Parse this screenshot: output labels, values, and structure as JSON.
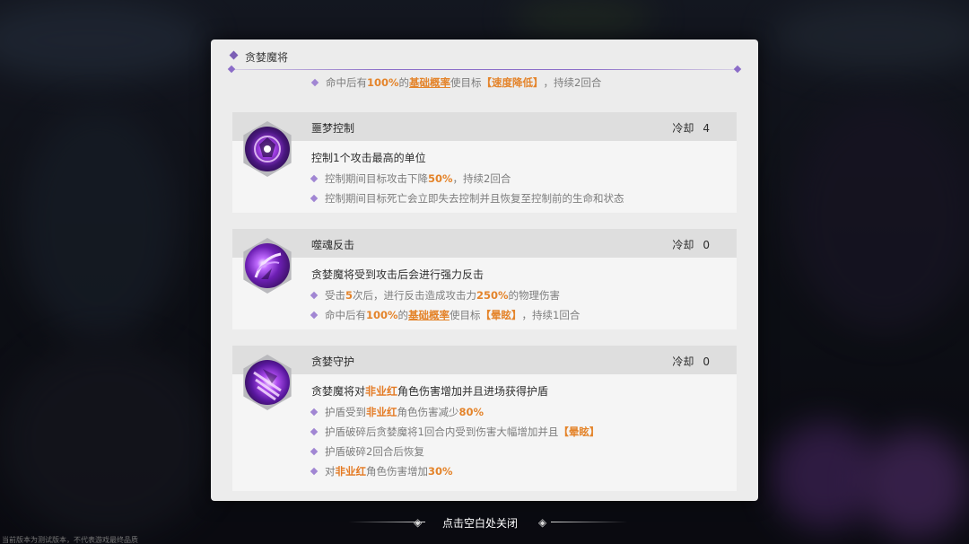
{
  "header": {
    "title": "贪婪魔将"
  },
  "top_effect": {
    "prefix": "命中后有",
    "rate": "100%",
    "mid": "的",
    "term": "基础概率",
    "after": "使目标",
    "status": "【速度降低】",
    "suffix": "，持续2回合"
  },
  "skills": [
    {
      "name": "噩梦控制",
      "cooldown_label": "冷却",
      "cooldown_value": "4",
      "icon": "nightmare-control-icon",
      "description": "控制1个攻击最高的单位",
      "effects": {
        "e1_prefix": "控制期间目标攻击下降",
        "e1_value": "50%",
        "e1_suffix": "，持续2回合",
        "e2_text": "控制期间目标死亡会立即失去控制并且恢复至控制前的生命和状态"
      }
    },
    {
      "name": "噬魂反击",
      "cooldown_label": "冷却",
      "cooldown_value": "0",
      "icon": "soul-counter-icon",
      "description": "贪婪魔将受到攻击后会进行强力反击",
      "effects": {
        "e1_prefix": "受击",
        "e1_count": "5",
        "e1_mid": "次后，进行反击造成攻击力",
        "e1_value": "250%",
        "e1_suffix": "的物理伤害",
        "e2_prefix": "命中后有",
        "e2_rate": "100%",
        "e2_mid": "的",
        "e2_term": "基础概率",
        "e2_after": "使目标",
        "e2_status": "【晕眩】",
        "e2_suffix": "，持续1回合"
      }
    },
    {
      "name": "贪婪守护",
      "cooldown_label": "冷却",
      "cooldown_value": "0",
      "icon": "greed-guard-icon",
      "description_prefix": "贪婪魔将对",
      "description_key": "非业红",
      "description_suffix": "角色伤害增加并且进场获得护盾",
      "effects": {
        "e1_prefix": "护盾受到",
        "e1_key": "非业红",
        "e1_mid": "角色伤害减少",
        "e1_value": "80%",
        "e2_prefix": "护盾破碎后贪婪魔将1回合内受到伤害大幅增加并且",
        "e2_status": "【晕眩】",
        "e3_text": "护盾破碎2回合后恢复",
        "e4_prefix": "对",
        "e4_key": "非业红",
        "e4_mid": "角色伤害增加",
        "e4_value": "30%"
      }
    }
  ],
  "footer": {
    "close_hint": "点击空白处关闭",
    "disclaimer": "当前版本为测试版本，不代表游戏最终品质"
  },
  "colors": {
    "accent_purple": "#8b6cc8",
    "highlight_orange": "#e4842b",
    "panel_bg": "#ececec"
  }
}
